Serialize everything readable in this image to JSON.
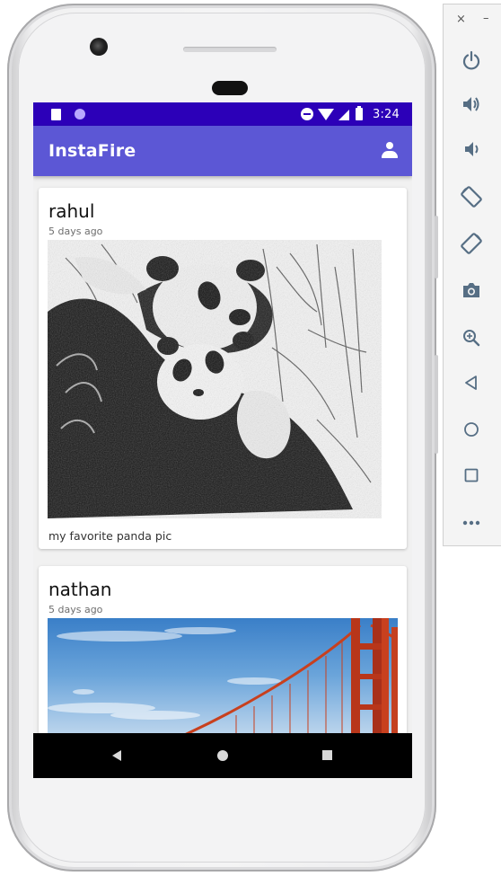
{
  "status_bar": {
    "time": "3:24"
  },
  "app_bar": {
    "title": "InstaFire"
  },
  "posts": [
    {
      "username": "rahul",
      "timestamp": "5 days ago",
      "caption": "my favorite panda pic"
    },
    {
      "username": "nathan",
      "timestamp": "5 days ago"
    }
  ],
  "emulator_toolbar": {
    "close_label": "×",
    "minimize_label": "–",
    "tools": [
      "power-icon",
      "volume-up-icon",
      "volume-down-icon",
      "rotate-left-icon",
      "rotate-right-icon",
      "camera-icon",
      "zoom-icon",
      "back-icon",
      "home-icon",
      "overview-icon",
      "more-icon"
    ]
  },
  "colors": {
    "status_bar": "#2c00b8",
    "app_bar": "#5c57d5",
    "nav_bar": "#000000",
    "bridge_orange": "#c8401e",
    "emulator_icon": "#566e84"
  }
}
